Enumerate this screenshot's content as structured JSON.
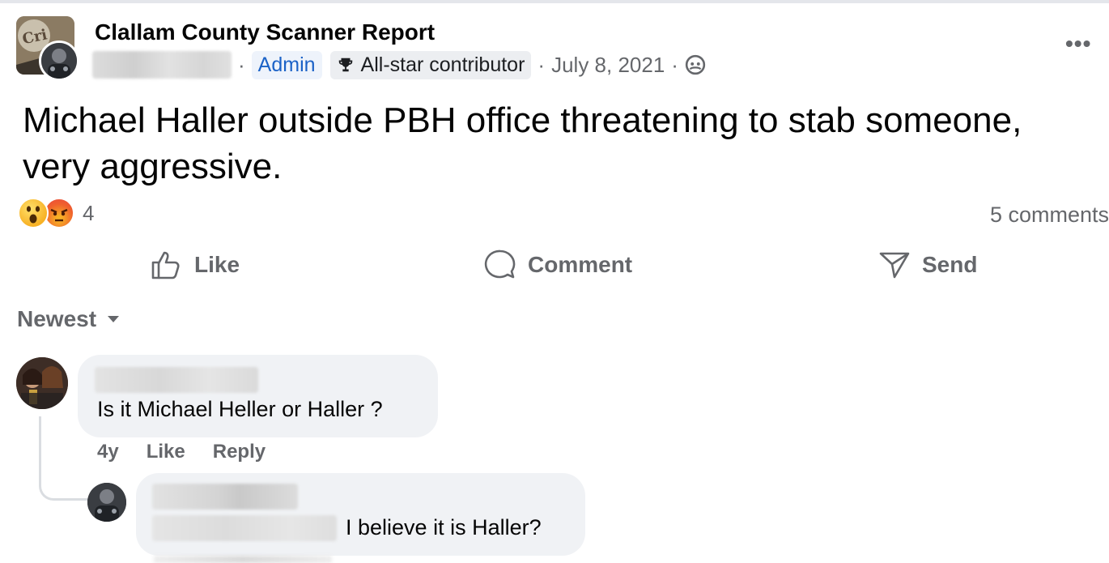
{
  "post": {
    "group_name": "Clallam County Scanner Report",
    "admin_badge": "Admin",
    "allstar_badge": "All-star contributor",
    "date": "July 8, 2021",
    "separator": "·",
    "more_icon": "more-horizontal-icon",
    "privacy_icon": "members-icon",
    "text": "Michael Haller outside PBH office threatening to stab someone, very aggressive.",
    "reactions": {
      "icons": [
        "wow-reaction-icon",
        "angry-reaction-icon"
      ],
      "count": "4"
    },
    "comments_count": "5 comments"
  },
  "actions": {
    "like_label": "Like",
    "comment_label": "Comment",
    "send_label": "Send"
  },
  "sort": {
    "label": "Newest"
  },
  "comments": [
    {
      "text": "Is it Michael Heller or Haller ?",
      "time": "4y",
      "like_label": "Like",
      "reply_label": "Reply"
    },
    {
      "text": "I believe it is Haller?"
    }
  ],
  "colors": {
    "admin_blue": "#1b62c7",
    "meta_gray": "#65676b",
    "bubble_bg": "#f0f2f5"
  }
}
